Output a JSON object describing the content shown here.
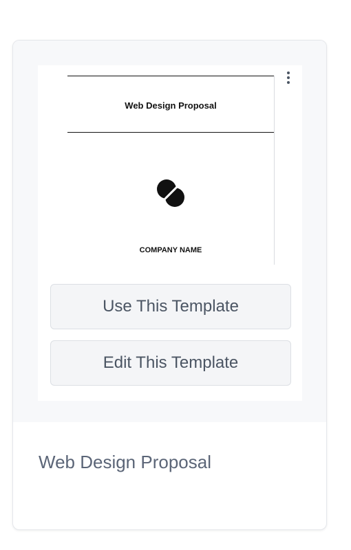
{
  "template_card": {
    "preview": {
      "doc_title": "Web Design Proposal",
      "company_name": "COMPANY NAME",
      "logo_icon": "company-logo-icon"
    },
    "menu_icon": "kebab-menu-icon",
    "actions": {
      "use_label": "Use This Template",
      "edit_label": "Edit This Template"
    },
    "title": "Web Design Proposal"
  },
  "colors": {
    "button_bg": "#f4f5f7",
    "button_text": "#4b5563",
    "title_text": "#5b6577",
    "preview_bg": "#f7f8fa"
  }
}
